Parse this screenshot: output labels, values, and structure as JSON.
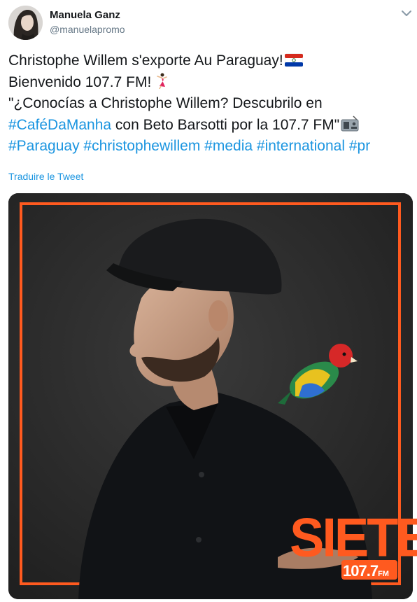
{
  "author": {
    "name": "Manuela Ganz",
    "handle": "@manuelapromo"
  },
  "tweet": {
    "line1_text": "Christophe Willem s'exporte Au Paraguay!",
    "line2_text": "Bienvenido 107.7 FM!",
    "line3_text": "\"¿Conocías a Christophe Willem? Descubrilo en",
    "line4_hashtag": "#CaféDaManha",
    "line4_text": " con Beto Barsotti por la 107.7 FM\"",
    "hashtags": [
      "#Paraguay",
      "#christophewillem",
      "#media",
      "#international",
      "#pr"
    ],
    "translate_label": "Traduire le Tweet"
  },
  "icons": {
    "line1_emoji": "paraguay-flag-icon",
    "line2_emoji": "dancer-icon",
    "line4_emoji": "radio-icon",
    "caret": "chevron-down-icon"
  },
  "media_logo": {
    "brand": "SIETE",
    "frequency": "107.7",
    "unit": "FM"
  },
  "colors": {
    "link": "#1b95e0",
    "frame": "#ff5a1f",
    "photo_bg": "#2a2a2a"
  }
}
